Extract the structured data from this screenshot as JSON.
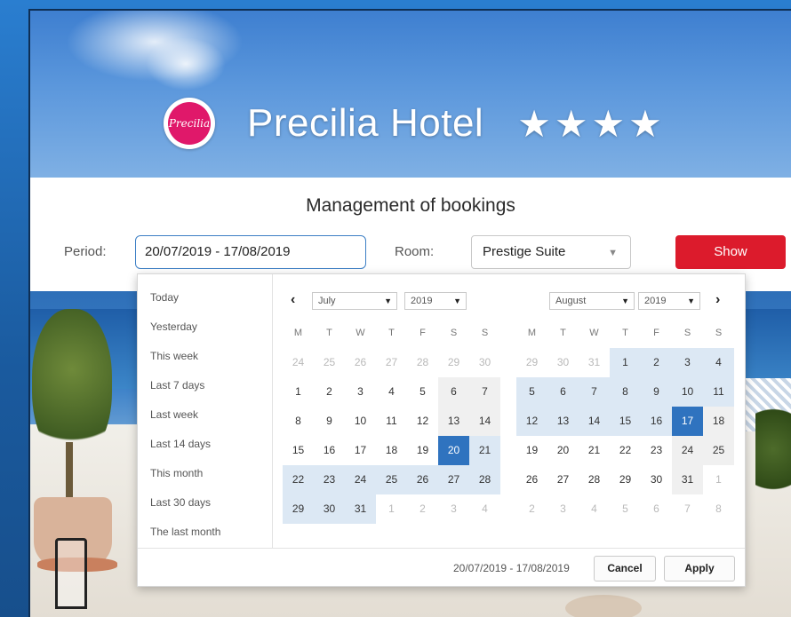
{
  "header": {
    "logo_text": "Precilia",
    "hotel_name": "Precilia Hotel",
    "stars": "★★★★"
  },
  "form": {
    "title": "Management of bookings",
    "period_label": "Period:",
    "period_value": "20/07/2019 - 17/08/2019",
    "room_label": "Room:",
    "room_value": "Prestige Suite",
    "show_label": "Show"
  },
  "datepicker": {
    "presets": [
      "Today",
      "Yesterday",
      "This week",
      "Last 7 days",
      "Last week",
      "Last 14 days",
      "This month",
      "Last 30 days",
      "The last month"
    ],
    "weekdays": [
      "M",
      "T",
      "W",
      "T",
      "F",
      "S",
      "S"
    ],
    "left": {
      "month": "July",
      "year": "2019",
      "weeks": [
        [
          "24",
          "25",
          "26",
          "27",
          "28",
          "29",
          "30"
        ],
        [
          "1",
          "2",
          "3",
          "4",
          "5",
          "6",
          "7"
        ],
        [
          "8",
          "9",
          "10",
          "11",
          "12",
          "13",
          "14"
        ],
        [
          "15",
          "16",
          "17",
          "18",
          "19",
          "20",
          "21"
        ],
        [
          "22",
          "23",
          "24",
          "25",
          "26",
          "27",
          "28"
        ],
        [
          "29",
          "30",
          "31",
          "1",
          "2",
          "3",
          "4"
        ]
      ]
    },
    "right": {
      "month": "August",
      "year": "2019",
      "weeks": [
        [
          "29",
          "30",
          "31",
          "1",
          "2",
          "3",
          "4"
        ],
        [
          "5",
          "6",
          "7",
          "8",
          "9",
          "10",
          "11"
        ],
        [
          "12",
          "13",
          "14",
          "15",
          "16",
          "17",
          "18"
        ],
        [
          "19",
          "20",
          "21",
          "22",
          "23",
          "24",
          "25"
        ],
        [
          "26",
          "27",
          "28",
          "29",
          "30",
          "31",
          "1"
        ],
        [
          "2",
          "3",
          "4",
          "5",
          "6",
          "7",
          "8"
        ]
      ]
    },
    "range_text": "20/07/2019 - 17/08/2019",
    "cancel_label": "Cancel",
    "apply_label": "Apply",
    "prev_icon": "‹",
    "next_icon": "›"
  },
  "colors": {
    "accent": "#2f73bf",
    "show_button": "#dc1b2c",
    "range": "#dce8f4"
  }
}
